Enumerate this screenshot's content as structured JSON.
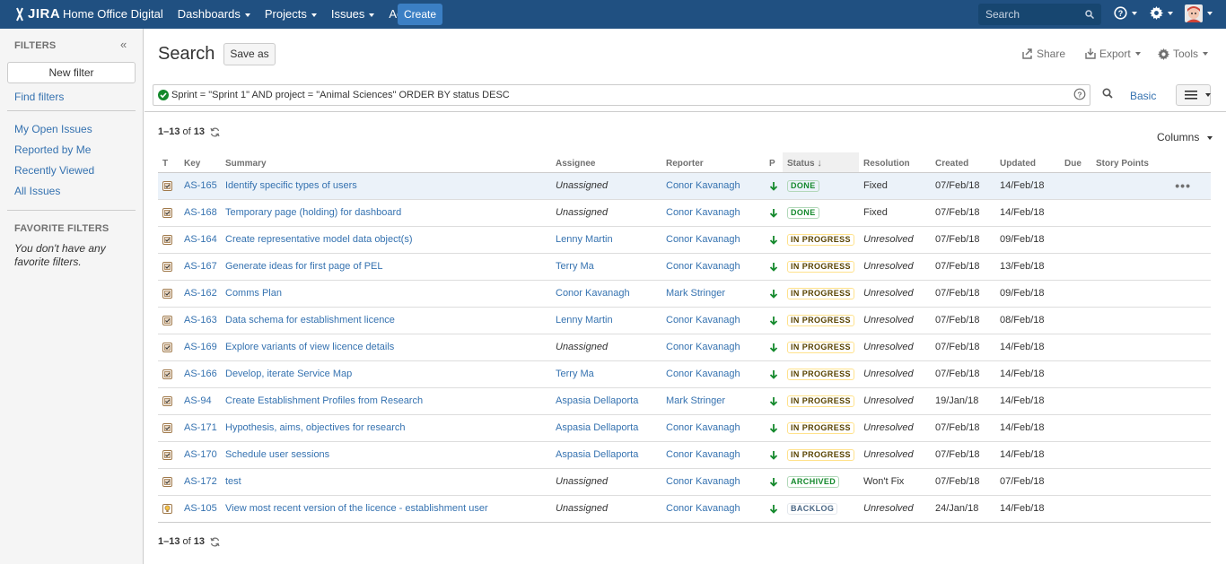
{
  "header": {
    "logo_text": "JIRA",
    "nav": [
      {
        "label": "Home Office Digital",
        "caret": false
      },
      {
        "label": "Dashboards",
        "caret": true
      },
      {
        "label": "Projects",
        "caret": true
      },
      {
        "label": "Issues",
        "caret": true
      },
      {
        "label": "Agile",
        "caret": true
      }
    ],
    "create_label": "Create",
    "search_placeholder": "Search"
  },
  "sidebar": {
    "heading": "FILTERS",
    "new_filter_label": "New filter",
    "find_filters": "Find filters",
    "filters": [
      "My Open Issues",
      "Reported by Me",
      "Recently Viewed",
      "All Issues"
    ],
    "favorite_heading": "FAVORITE FILTERS",
    "favorite_note": "You don't have any favorite filters."
  },
  "main": {
    "title": "Search",
    "save_as": "Save as",
    "share": "Share",
    "export": "Export",
    "tools": "Tools",
    "query": "Sprint = \"Sprint 1\" AND project = \"Animal Sciences\" ORDER BY status DESC",
    "basic_label": "Basic",
    "count": {
      "range": "1–13",
      "of": "of",
      "total": "13"
    },
    "columns_label": "Columns"
  },
  "table": {
    "headers": {
      "type": "T",
      "key": "Key",
      "summary": "Summary",
      "assignee": "Assignee",
      "reporter": "Reporter",
      "priority": "P",
      "status": "Status",
      "resolution": "Resolution",
      "created": "Created",
      "updated": "Updated",
      "due": "Due",
      "story_points": "Story Points"
    },
    "rows": [
      {
        "type": "task",
        "key": "AS-165",
        "summary": "Identify specific types of users",
        "assignee": "Unassigned",
        "reporter": "Conor Kavanagh",
        "status": "DONE",
        "status_color": "green",
        "resolution": "Fixed",
        "created": "07/Feb/18",
        "updated": "14/Feb/18"
      },
      {
        "type": "task",
        "key": "AS-168",
        "summary": "Temporary page (holding) for dashboard",
        "assignee": "Unassigned",
        "reporter": "Conor Kavanagh",
        "status": "DONE",
        "status_color": "green",
        "resolution": "Fixed",
        "created": "07/Feb/18",
        "updated": "14/Feb/18"
      },
      {
        "type": "task",
        "key": "AS-164",
        "summary": "Create representative model data object(s)",
        "assignee": "Lenny Martin",
        "reporter": "Conor Kavanagh",
        "status": "IN PROGRESS",
        "status_color": "yellow",
        "resolution": "Unresolved",
        "created": "07/Feb/18",
        "updated": "09/Feb/18"
      },
      {
        "type": "task",
        "key": "AS-167",
        "summary": "Generate ideas for first page of PEL",
        "assignee": "Terry Ma",
        "reporter": "Conor Kavanagh",
        "status": "IN PROGRESS",
        "status_color": "yellow",
        "resolution": "Unresolved",
        "created": "07/Feb/18",
        "updated": "13/Feb/18"
      },
      {
        "type": "task",
        "key": "AS-162",
        "summary": "Comms Plan",
        "assignee": "Conor Kavanagh",
        "reporter": "Mark Stringer",
        "status": "IN PROGRESS",
        "status_color": "yellow",
        "resolution": "Unresolved",
        "created": "07/Feb/18",
        "updated": "09/Feb/18"
      },
      {
        "type": "task",
        "key": "AS-163",
        "summary": "Data schema for establishment licence",
        "assignee": "Lenny Martin",
        "reporter": "Conor Kavanagh",
        "status": "IN PROGRESS",
        "status_color": "yellow",
        "resolution": "Unresolved",
        "created": "07/Feb/18",
        "updated": "08/Feb/18"
      },
      {
        "type": "task",
        "key": "AS-169",
        "summary": "Explore variants of view licence details",
        "assignee": "Unassigned",
        "reporter": "Conor Kavanagh",
        "status": "IN PROGRESS",
        "status_color": "yellow",
        "resolution": "Unresolved",
        "created": "07/Feb/18",
        "updated": "14/Feb/18"
      },
      {
        "type": "task",
        "key": "AS-166",
        "summary": "Develop, iterate Service Map",
        "assignee": "Terry Ma",
        "reporter": "Conor Kavanagh",
        "status": "IN PROGRESS",
        "status_color": "yellow",
        "resolution": "Unresolved",
        "created": "07/Feb/18",
        "updated": "14/Feb/18"
      },
      {
        "type": "task",
        "key": "AS-94",
        "summary": "Create Establishment Profiles from Research",
        "assignee": "Aspasia Dellaporta",
        "reporter": "Mark Stringer",
        "status": "IN PROGRESS",
        "status_color": "yellow",
        "resolution": "Unresolved",
        "created": "19/Jan/18",
        "updated": "14/Feb/18"
      },
      {
        "type": "task",
        "key": "AS-171",
        "summary": "Hypothesis, aims, objectives for research",
        "assignee": "Aspasia Dellaporta",
        "reporter": "Conor Kavanagh",
        "status": "IN PROGRESS",
        "status_color": "yellow",
        "resolution": "Unresolved",
        "created": "07/Feb/18",
        "updated": "14/Feb/18"
      },
      {
        "type": "task",
        "key": "AS-170",
        "summary": "Schedule user sessions",
        "assignee": "Aspasia Dellaporta",
        "reporter": "Conor Kavanagh",
        "status": "IN PROGRESS",
        "status_color": "yellow",
        "resolution": "Unresolved",
        "created": "07/Feb/18",
        "updated": "14/Feb/18"
      },
      {
        "type": "task",
        "key": "AS-172",
        "summary": "test",
        "assignee": "Unassigned",
        "reporter": "Conor Kavanagh",
        "status": "ARCHIVED",
        "status_color": "green",
        "resolution": "Won't Fix",
        "created": "07/Feb/18",
        "updated": "07/Feb/18"
      },
      {
        "type": "story",
        "key": "AS-105",
        "summary": "View most recent version of the licence - establishment user",
        "assignee": "Unassigned",
        "reporter": "Conor Kavanagh",
        "status": "BACKLOG",
        "status_color": "blue",
        "resolution": "Unresolved",
        "created": "24/Jan/18",
        "updated": "14/Feb/18"
      }
    ]
  }
}
